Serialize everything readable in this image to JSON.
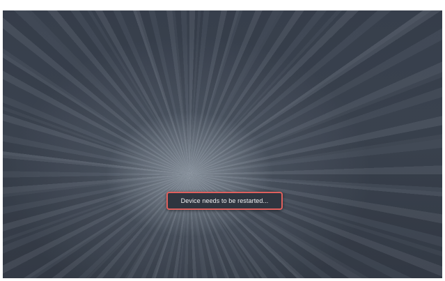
{
  "screen": {
    "background": "dark radial-streak wallpaper",
    "toast": {
      "message": "Device needs to be restarted...",
      "border_color": "#e0615e",
      "background_color": "#2f353f",
      "text_color": "#f3f4f6"
    }
  }
}
